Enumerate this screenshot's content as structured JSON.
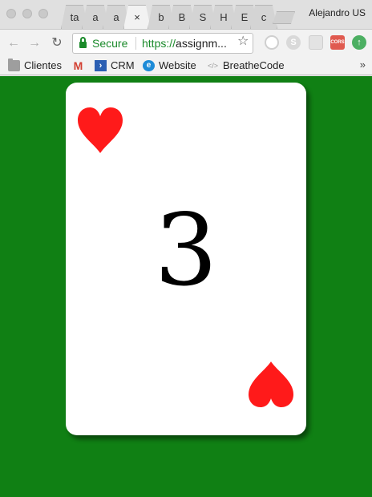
{
  "browser": {
    "tabs": [
      {
        "label": "ta"
      },
      {
        "label": "a"
      },
      {
        "label": "a"
      },
      {
        "label": "×",
        "active": true
      },
      {
        "label": "b"
      },
      {
        "label": "B"
      },
      {
        "label": "S"
      },
      {
        "label": "H"
      },
      {
        "label": "E"
      },
      {
        "label": "c"
      }
    ],
    "profile_name": "Alejandro US",
    "address_bar": {
      "secure_label": "Secure",
      "url_scheme": "https://",
      "url_rest": "assignm..."
    },
    "extensions": [
      "extension-icon",
      "skype-icon",
      "extension-icon",
      "cors-icon",
      "upload-icon"
    ],
    "extension_labels": {
      "cors": "CORS",
      "skype": "S",
      "upload": "↑"
    }
  },
  "bookmarks": [
    {
      "label": "Clientes",
      "icon": "folder-icon"
    },
    {
      "label": "",
      "icon": "gmail-icon"
    },
    {
      "label": "CRM",
      "icon": "crm-icon"
    },
    {
      "label": "Website",
      "icon": "website-icon"
    },
    {
      "label": "BreatheCode",
      "icon": "code-icon"
    }
  ],
  "bookmarks_overflow": "»",
  "card": {
    "rank": "3",
    "suit": "hearts",
    "suit_color": "#ff1a1a",
    "background": "#ffffff"
  },
  "page_background": "#108014"
}
